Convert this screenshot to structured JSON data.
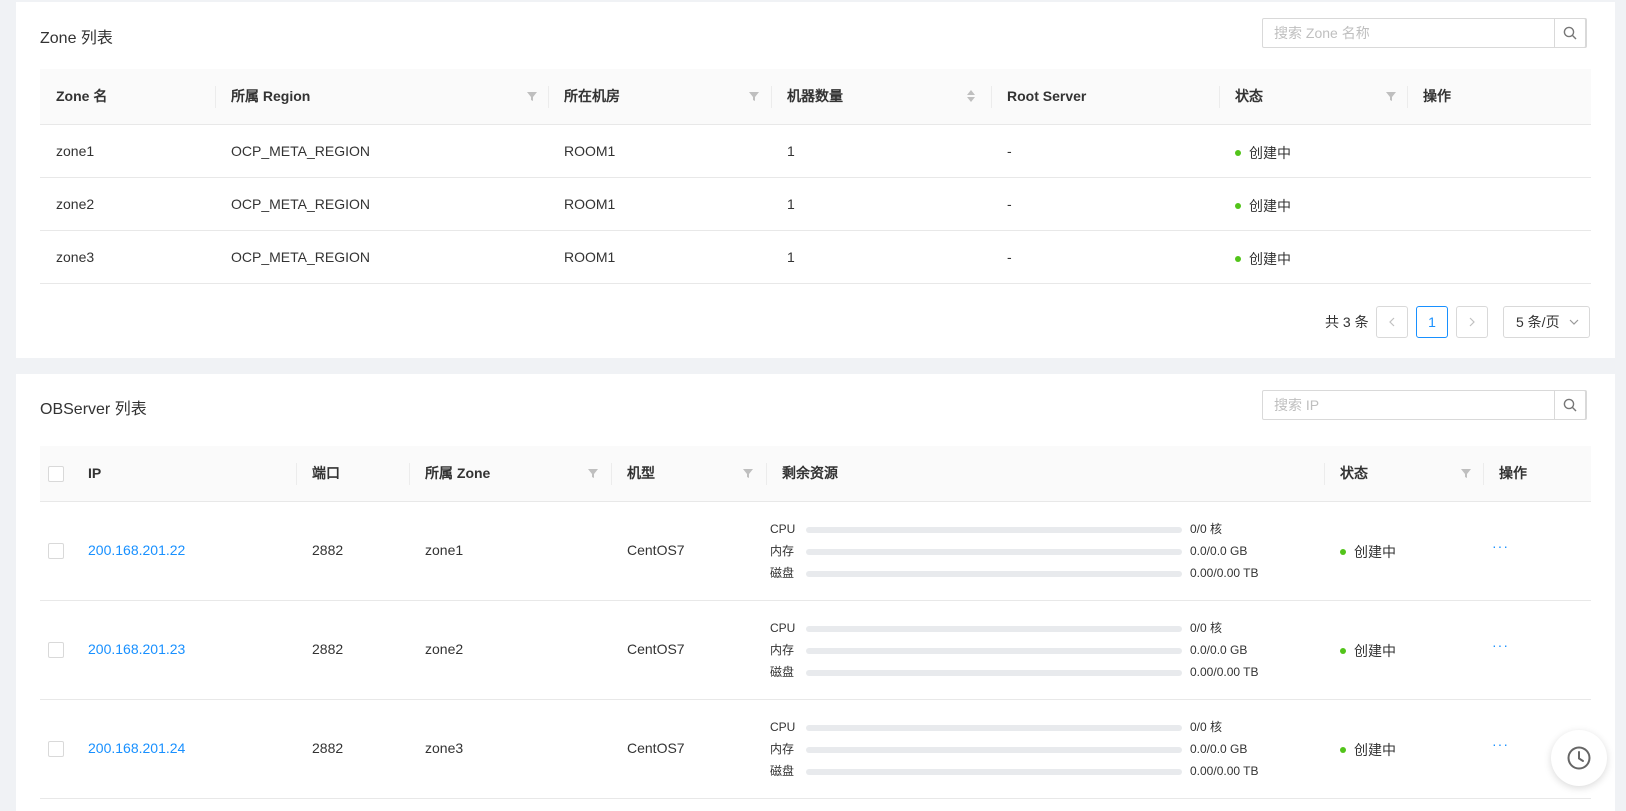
{
  "zone_section": {
    "title": "Zone 列表",
    "search_placeholder": "搜索 Zone 名称",
    "columns": {
      "name": "Zone 名",
      "region": "所属 Region",
      "idc": "所在机房",
      "server_count": "机器数量",
      "root_server": "Root Server",
      "status": "状态",
      "action": "操作"
    },
    "rows": [
      {
        "name": "zone1",
        "region": "OCP_META_REGION",
        "idc": "ROOM1",
        "server_count": "1",
        "root_server": "-",
        "status": "创建中"
      },
      {
        "name": "zone2",
        "region": "OCP_META_REGION",
        "idc": "ROOM1",
        "server_count": "1",
        "root_server": "-",
        "status": "创建中"
      },
      {
        "name": "zone3",
        "region": "OCP_META_REGION",
        "idc": "ROOM1",
        "server_count": "1",
        "root_server": "-",
        "status": "创建中"
      }
    ],
    "pagination": {
      "total": "共 3 条",
      "current_page": "1",
      "page_size": "5 条/页"
    }
  },
  "observer_section": {
    "title": "OBServer 列表",
    "search_placeholder": "搜索 IP",
    "columns": {
      "ip": "IP",
      "port": "端口",
      "zone": "所属 Zone",
      "os": "机型",
      "resources": "剩余资源",
      "status": "状态",
      "action": "操作"
    },
    "resource_labels": {
      "cpu": "CPU",
      "memory": "内存",
      "disk": "磁盘"
    },
    "rows": [
      {
        "ip": "200.168.201.22",
        "port": "2882",
        "zone": "zone1",
        "os": "CentOS7",
        "cpu": "0/0 核",
        "memory": "0.0/0.0 GB",
        "disk": "0.00/0.00 TB",
        "cpu_fill": 0,
        "memory_fill": 0,
        "disk_fill": 0,
        "status": "创建中",
        "action": "···"
      },
      {
        "ip": "200.168.201.23",
        "port": "2882",
        "zone": "zone2",
        "os": "CentOS7",
        "cpu": "0/0 核",
        "memory": "0.0/0.0 GB",
        "disk": "0.00/0.00 TB",
        "cpu_fill": 0,
        "memory_fill": 0,
        "disk_fill": 0,
        "status": "创建中",
        "action": "···"
      },
      {
        "ip": "200.168.201.24",
        "port": "2882",
        "zone": "zone3",
        "os": "CentOS7",
        "cpu": "0/0 核",
        "memory": "0.0/0.0 GB",
        "disk": "0.00/0.00 TB",
        "cpu_fill": 0,
        "memory_fill": 0,
        "disk_fill": 0,
        "status": "创建中",
        "action": "···"
      }
    ]
  },
  "colors": {
    "link": "#1890ff",
    "status_creating": "#52c41a",
    "background": "#f0f2f5"
  },
  "icons": [
    "search-icon",
    "filter-icon",
    "sort-icon",
    "chevron-left-icon",
    "chevron-right-icon",
    "chevron-down-icon",
    "history-clock-icon"
  ]
}
